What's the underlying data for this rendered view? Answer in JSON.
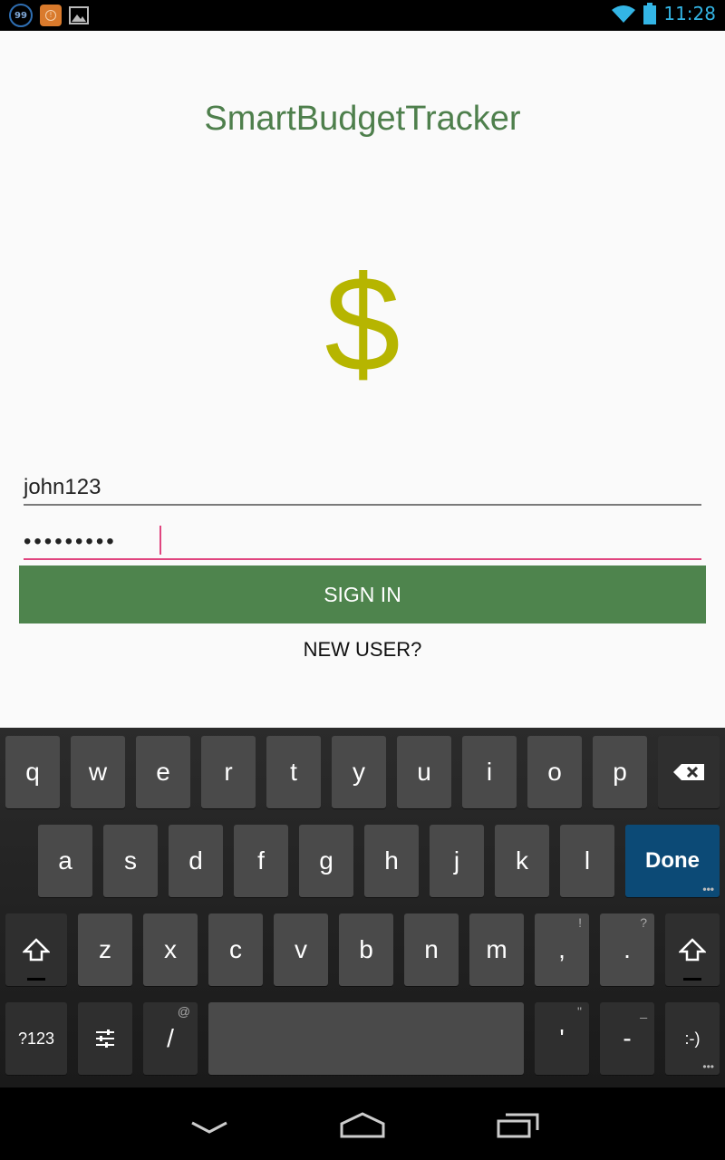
{
  "status_bar": {
    "notification_badge": "99",
    "time": "11:28"
  },
  "app": {
    "title": "SmartBudgetTracker",
    "logo_symbol": "$",
    "username_value": "john123",
    "password_mask": "•••••••••",
    "sign_in_label": "SIGN IN",
    "new_user_label": "NEW USER?"
  },
  "keyboard": {
    "row1": [
      "q",
      "w",
      "e",
      "r",
      "t",
      "y",
      "u",
      "i",
      "o",
      "p"
    ],
    "row2": [
      "a",
      "s",
      "d",
      "f",
      "g",
      "h",
      "j",
      "k",
      "l"
    ],
    "done_label": "Done",
    "row3": [
      "z",
      "x",
      "c",
      "v",
      "b",
      "n",
      "m",
      ",",
      "."
    ],
    "row3_hints": {
      ",": "!",
      ".": "?"
    },
    "symbols_label": "?123",
    "slash_label": "/",
    "slash_hint": "@",
    "apostrophe_label": "'",
    "apostrophe_hint": "\"",
    "dash_label": "-",
    "dash_hint": "_",
    "emoji_label": ":-)"
  },
  "colors": {
    "title": "#4e7f4c",
    "logo": "#b6b500",
    "primary_button": "#4e844d",
    "accent": "#e0457f",
    "status_icon": "#33b5e5",
    "done_key": "#0c4a76"
  }
}
